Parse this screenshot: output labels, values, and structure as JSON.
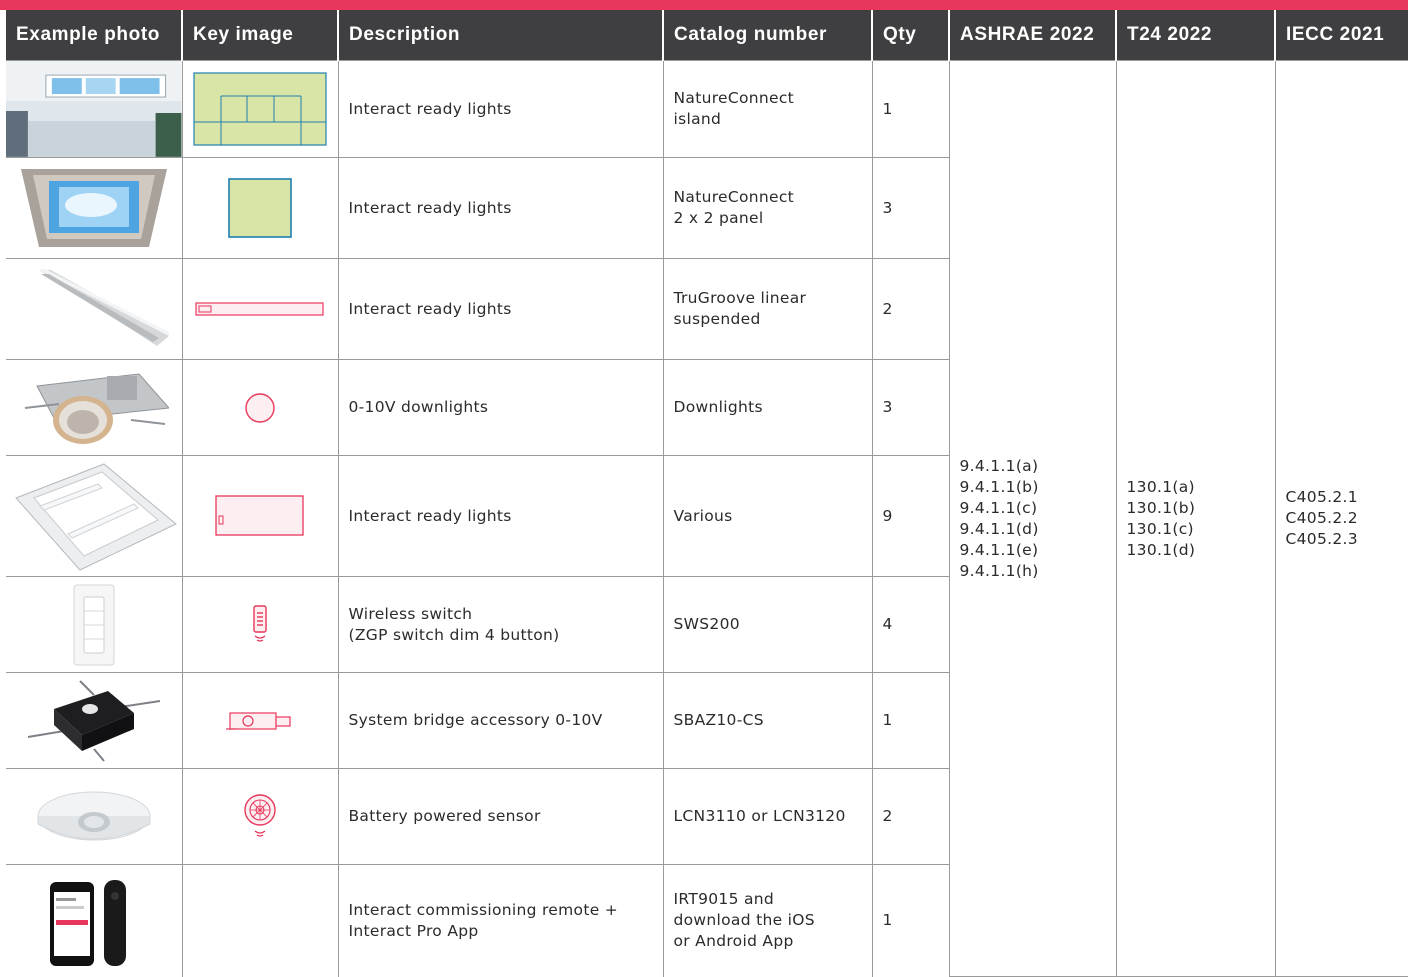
{
  "header": {
    "example_photo": "Example photo",
    "key_image": "Key image",
    "description": "Description",
    "catalog_number": "Catalog number",
    "qty": "Qty",
    "ashrae": "ASHRAE 2022",
    "t24": "T24 2022",
    "iecc": "IECC 2021"
  },
  "rows": [
    {
      "description": "Interact ready lights",
      "catalog": "NatureConnect\nisland",
      "qty": "1",
      "photo_icon": "skylight-island-photo",
      "key_icon": "island-grid-key"
    },
    {
      "description": "Interact ready lights",
      "catalog": "NatureConnect\n2 x 2 panel",
      "qty": "3",
      "photo_icon": "panel-2x2-photo",
      "key_icon": "panel-square-key"
    },
    {
      "description": "Interact ready lights",
      "catalog": "TruGroove linear\nsuspended",
      "qty": "2",
      "photo_icon": "linear-suspended-photo",
      "key_icon": "linear-bar-key"
    },
    {
      "description": "0-10V downlights",
      "catalog": "Downlights",
      "qty": "3",
      "photo_icon": "downlight-housing-photo",
      "key_icon": "circle-key"
    },
    {
      "description": "Interact ready lights",
      "catalog": "Various",
      "qty": "9",
      "photo_icon": "troffer-photo",
      "key_icon": "rectangle-key"
    },
    {
      "description": "Wireless switch\n(ZGP switch dim 4 button)",
      "catalog": "SWS200",
      "qty": "4",
      "photo_icon": "wall-switch-photo",
      "key_icon": "wireless-switch-key"
    },
    {
      "description": "System bridge accessory 0-10V",
      "catalog": "SBAZ10-CS",
      "qty": "1",
      "photo_icon": "bridge-box-photo",
      "key_icon": "bridge-key"
    },
    {
      "description": "Battery powered sensor",
      "catalog": "LCN3110 or LCN3120",
      "qty": "2",
      "photo_icon": "ceiling-sensor-photo",
      "key_icon": "sensor-key"
    },
    {
      "description": "Interact commissioning remote +\nInteract Pro App",
      "catalog": "IRT9015 and\ndownload the iOS\nor Android App",
      "qty": "1",
      "photo_icon": "phone-remote-photo",
      "key_icon": ""
    }
  ],
  "codes": {
    "ashrae": "9.4.1.1(a)\n9.4.1.1(b)\n9.4.1.1(c)\n9.4.1.1(d)\n9.4.1.1(e)\n9.4.1.1(h)",
    "t24": "130.1(a)\n130.1(b)\n130.1(c)\n130.1(d)",
    "iecc": "C405.2.1\nC405.2.2\nC405.2.3"
  },
  "colors": {
    "accent": "#e8365c",
    "header_bg": "#3f3f41",
    "key_fill": "#d9e5a6",
    "key_stroke": "#1f7fb0"
  }
}
